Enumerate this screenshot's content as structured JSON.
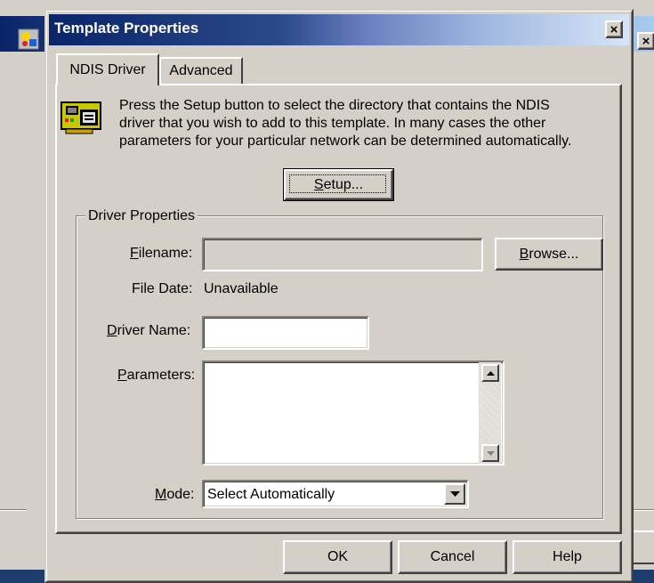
{
  "background_window": {
    "close_glyph": "×"
  },
  "dialog": {
    "title": "Template Properties",
    "close_glyph": "×"
  },
  "tabs": [
    {
      "label": "NDIS Driver"
    },
    {
      "label": "Advanced"
    }
  ],
  "intro": {
    "line1": "Press the Setup button to select the directory that contains the NDIS",
    "line2": "driver that you wish to add to this template. In many cases the other",
    "line3": "parameters for your particular network can be determined automatically."
  },
  "setup_button": {
    "pre": "",
    "u": "S",
    "post": "etup..."
  },
  "group": {
    "title": "Driver Properties"
  },
  "filename": {
    "label_u": "F",
    "label_rest": "ilename:",
    "value": ""
  },
  "browse_button": {
    "u": "B",
    "rest": "rowse..."
  },
  "file_date": {
    "label": "File Date:",
    "value": "Unavailable"
  },
  "driver_name": {
    "label_u": "D",
    "label_rest": "river Name:",
    "value": ""
  },
  "parameters": {
    "label_u": "P",
    "label_rest": "arameters:",
    "value": ""
  },
  "mode": {
    "label_u": "M",
    "label_rest": "ode:",
    "value": "Select Automatically"
  },
  "buttons": {
    "ok": "OK",
    "cancel": "Cancel",
    "help": "Help"
  },
  "icons": [
    "app-icon",
    "network-card-icon",
    "scroll-up-icon",
    "scroll-down-icon",
    "dropdown-arrow-icon",
    "close-icon"
  ]
}
